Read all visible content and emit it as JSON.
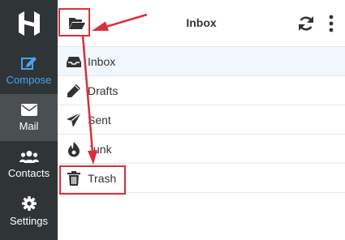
{
  "sidebar": {
    "logo": "H",
    "items": [
      {
        "label": "Compose",
        "icon": "compose-icon"
      },
      {
        "label": "Mail",
        "icon": "mail-icon"
      },
      {
        "label": "Contacts",
        "icon": "contacts-icon"
      },
      {
        "label": "Settings",
        "icon": "gear-icon"
      }
    ]
  },
  "header": {
    "title": "Inbox",
    "folder_icon": "folder-open-icon",
    "refresh_icon": "refresh-icon",
    "more_icon": "more-vertical-icon"
  },
  "folders": [
    {
      "label": "Inbox",
      "icon": "inbox-icon",
      "active": true
    },
    {
      "label": "Drafts",
      "icon": "pencil-icon"
    },
    {
      "label": "Sent",
      "icon": "send-icon"
    },
    {
      "label": "Junk",
      "icon": "fire-icon"
    },
    {
      "label": "Trash",
      "icon": "trash-icon"
    }
  ],
  "colors": {
    "sidebar_bg": "#2f3537",
    "accent": "#4aa3ef",
    "annotation": "#d7303a"
  }
}
